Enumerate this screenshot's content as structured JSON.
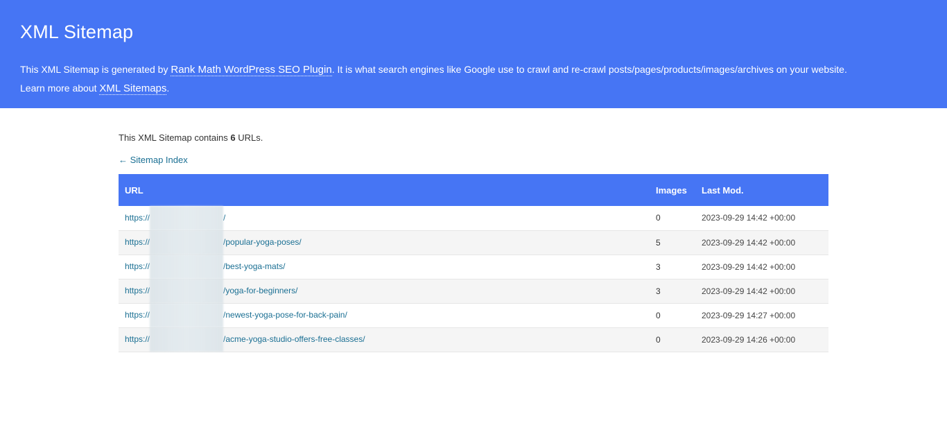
{
  "header": {
    "title": "XML Sitemap",
    "desc_part1": "This XML Sitemap is generated by ",
    "plugin_link": "Rank Math WordPress SEO Plugin",
    "desc_part2": ". It is what search engines like Google use to crawl and re-crawl posts/pages/products/images/archives on your website.",
    "learn_more_prefix": "Learn more about ",
    "learn_more_link": "XML Sitemaps",
    "learn_more_suffix": "."
  },
  "summary": {
    "prefix": "This XML Sitemap contains ",
    "count": "6",
    "suffix": " URLs."
  },
  "back_link": "← Sitemap Index",
  "table": {
    "headers": {
      "url": "URL",
      "images": "Images",
      "last_mod": "Last Mod."
    },
    "rows": [
      {
        "url_prefix": "https://",
        "url_path": "/",
        "images": "0",
        "last_mod": "2023-09-29 14:42 +00:00"
      },
      {
        "url_prefix": "https://",
        "url_path": "/popular-yoga-poses/",
        "images": "5",
        "last_mod": "2023-09-29 14:42 +00:00"
      },
      {
        "url_prefix": "https://",
        "url_path": "/best-yoga-mats/",
        "images": "3",
        "last_mod": "2023-09-29 14:42 +00:00"
      },
      {
        "url_prefix": "https://",
        "url_path": "/yoga-for-beginners/",
        "images": "3",
        "last_mod": "2023-09-29 14:42 +00:00"
      },
      {
        "url_prefix": "https://",
        "url_path": "/newest-yoga-pose-for-back-pain/",
        "images": "0",
        "last_mod": "2023-09-29 14:27 +00:00"
      },
      {
        "url_prefix": "https://",
        "url_path": "/acme-yoga-studio-offers-free-classes/",
        "images": "0",
        "last_mod": "2023-09-29 14:26 +00:00"
      }
    ]
  },
  "colors": {
    "header_bg": "#4675f4",
    "link": "#1a6f93"
  }
}
